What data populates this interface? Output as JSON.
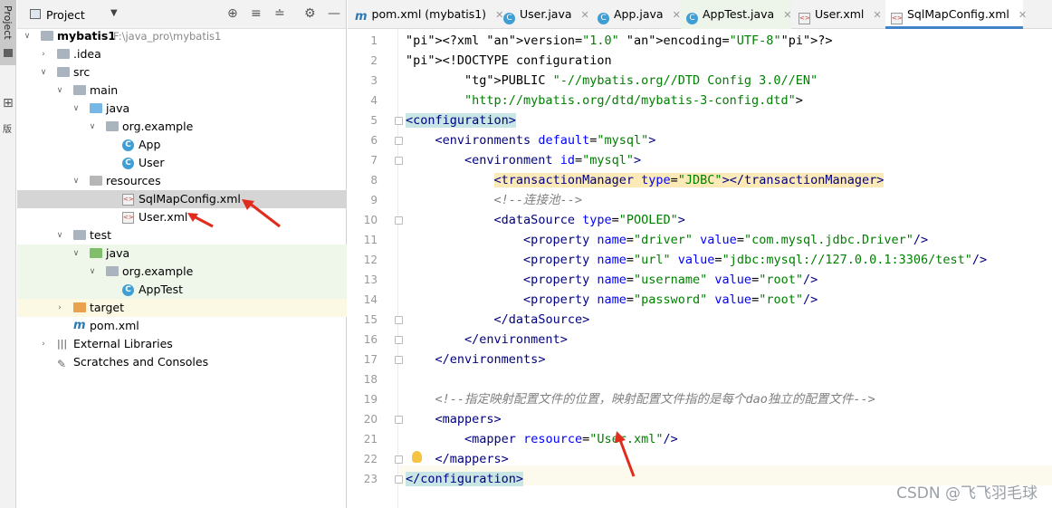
{
  "stripe": {
    "project_tab": "Project",
    "second_tab": "版"
  },
  "project_panel": {
    "title": "Project",
    "tree": [
      {
        "label": "mybatis1",
        "path": "F:\\java_pro\\mybatis1",
        "bold": true
      },
      {
        "label": ".idea"
      },
      {
        "label": "src"
      },
      {
        "label": "main"
      },
      {
        "label": "java"
      },
      {
        "label": "org.example"
      },
      {
        "label": "App"
      },
      {
        "label": "User"
      },
      {
        "label": "resources"
      },
      {
        "label": "SqlMapConfig.xml"
      },
      {
        "label": "User.xml"
      },
      {
        "label": "test"
      },
      {
        "label": "java"
      },
      {
        "label": "org.example"
      },
      {
        "label": "AppTest"
      },
      {
        "label": "target"
      },
      {
        "label": "pom.xml"
      },
      {
        "label": "External Libraries"
      },
      {
        "label": "Scratches and Consoles"
      }
    ]
  },
  "tabs": [
    {
      "label": "pom.xml (mybatis1)",
      "icon": "maven-icon"
    },
    {
      "label": "User.java",
      "icon": "class-icon"
    },
    {
      "label": "App.java",
      "icon": "class-icon"
    },
    {
      "label": "AppTest.java",
      "icon": "class-icon"
    },
    {
      "label": "User.xml",
      "icon": "xml-icon"
    },
    {
      "label": "SqlMapConfig.xml",
      "icon": "xml-icon",
      "active": true
    }
  ],
  "editor": {
    "line_numbers": [
      "1",
      "2",
      "3",
      "4",
      "5",
      "6",
      "7",
      "8",
      "9",
      "10",
      "11",
      "12",
      "13",
      "14",
      "15",
      "16",
      "17",
      "18",
      "19",
      "20",
      "21",
      "22",
      "23"
    ],
    "lines": [
      "<?xml version=\"1.0\" encoding=\"UTF-8\"?>",
      "<!DOCTYPE configuration",
      "        PUBLIC \"-//mybatis.org//DTD Config 3.0//EN\"",
      "        \"http://mybatis.org/dtd/mybatis-3-config.dtd\">",
      "<configuration>",
      "    <environments default=\"mysql\">",
      "        <environment id=\"mysql\">",
      "            <transactionManager type=\"JDBC\"></transactionManager>",
      "            <!--连接池-->",
      "            <dataSource type=\"POOLED\">",
      "                <property name=\"driver\" value=\"com.mysql.jdbc.Driver\"/>",
      "                <property name=\"url\" value=\"jdbc:mysql://127.0.0.1:3306/test\"/>",
      "                <property name=\"username\" value=\"root\"/>",
      "                <property name=\"password\" value=\"root\"/>",
      "            </dataSource>",
      "        </environment>",
      "    </environments>",
      "",
      "    <!--指定映射配置文件的位置，映射配置文件指的是每个dao独立的配置文件-->",
      "    <mappers>",
      "        <mapper resource=\"User.xml\"/>",
      "    </mappers>",
      "</configuration>"
    ]
  },
  "watermark": "CSDN @飞飞羽毛球",
  "colors": {
    "tag": "#000080",
    "attr": "#0000ff",
    "value": "#008000",
    "comment": "#808080",
    "annotation_arrow": "#e02b1f"
  }
}
